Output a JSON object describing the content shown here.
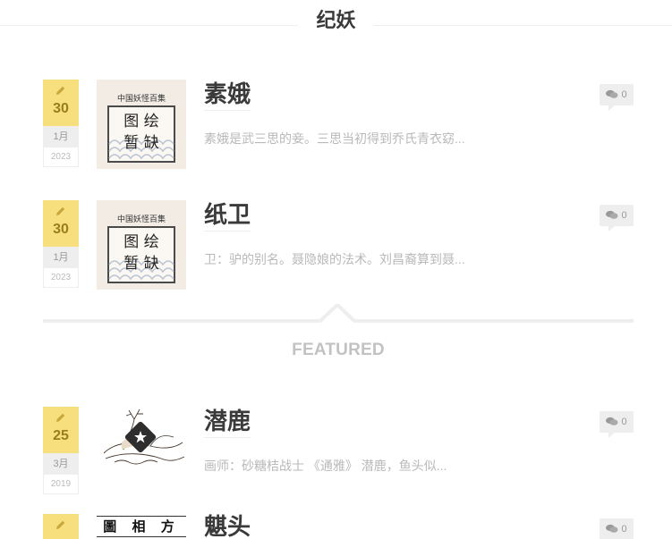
{
  "section": {
    "title": "纪妖"
  },
  "featured_label": "FEATURED",
  "placeholder_thumb": {
    "header": "中国妖怪百集",
    "line1": "图 绘",
    "line2": "暂 缺"
  },
  "posts": [
    {
      "title": "素娥",
      "day": "30",
      "month": "1月",
      "year": "2023",
      "excerpt": "素娥是武三思的妾。三思当初得到乔氏青衣窈...",
      "comments": "0",
      "thumb": "placeholder"
    },
    {
      "title": "纸卫",
      "day": "30",
      "month": "1月",
      "year": "2023",
      "excerpt": "卫：驴的别名。聂隐娘的法术。刘昌裔算到聂...",
      "comments": "0",
      "thumb": "placeholder"
    },
    {
      "title": "潜鹿",
      "day": "25",
      "month": "3月",
      "year": "2019",
      "excerpt": "画师：砂糖桔战士 《通雅》 潜鹿，鱼头似...",
      "comments": "0",
      "thumb": "deer"
    },
    {
      "title": "魌头",
      "day": "",
      "month": "",
      "year": "",
      "excerpt": "",
      "comments": "0",
      "thumb": "text",
      "thumb_text": "圖 相 方"
    }
  ],
  "colors": {
    "date_yellow": "#f8df7e",
    "date_day": "#9a7e1e",
    "gray_bg": "#eeeeee",
    "title": "#3a3a3a",
    "excerpt": "#b9b9b9"
  },
  "icons": {
    "date": "pencil-icon",
    "comments": "comments-icon",
    "featured_overlay": "star-icon"
  }
}
